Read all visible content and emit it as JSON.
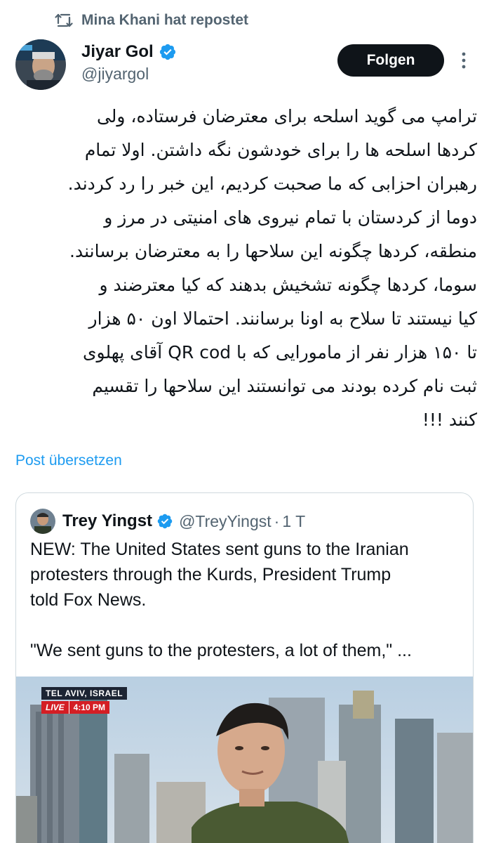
{
  "repost": {
    "text": "Mina Khani hat repostet",
    "icon": "repost-icon"
  },
  "author": {
    "name": "Jiyar Gol",
    "handle": "@jiyargol",
    "verified": true
  },
  "follow_label": "Folgen",
  "more_icon": "more-vertical-icon",
  "tweet_lines": [
    "ترامپ می گوید اسلحه برای معترضان فرستاده، ولی",
    "کردها اسلحه ها را برای خودشون نگه داشتن. اولا تمام",
    "رهبران احزابی که ما صحبت کردیم، این خبر را رد کردند.",
    "دوما از کردستان با تمام نیروی های امنیتی در مرز و",
    "منطقه، کردها چگونه این سلاحها را به معترضان برسانند.",
    "سوما، کردها چگونه تشخیش بدهند که کیا معترضند و",
    "کیا نیستند تا سلاح به اونا برسانند. احتمالا اون ۵۰ هزار",
    "تا ۱۵۰ هزار نفر از مامورایی که با QR cod آقای پهلوی",
    "ثبت نام کرده بودند می توانستند این سلاحها را تقسیم",
    "کنند !!!"
  ],
  "translate_label": "Post übersetzen",
  "quote": {
    "name": "Trey Yingst",
    "handle": "@TreyYingst",
    "separator": "·",
    "time": "1 T",
    "verified": true,
    "text_lines": [
      "NEW: The United States sent guns to the Iranian",
      "protesters through the Kurds, President Trump",
      "told Fox News."
    ],
    "text_line_2": "\"We sent guns to the protesters, a lot of them,\" ...",
    "media": {
      "location": "TEL AVIV, ISRAEL",
      "live": "LIVE",
      "time": "4:10 PM"
    }
  },
  "colors": {
    "text": "#0f1419",
    "secondary": "#536471",
    "link": "#1d9bf0",
    "border": "#cfd9de",
    "verified": "#1d9bf0",
    "live_red": "#d41e24"
  }
}
